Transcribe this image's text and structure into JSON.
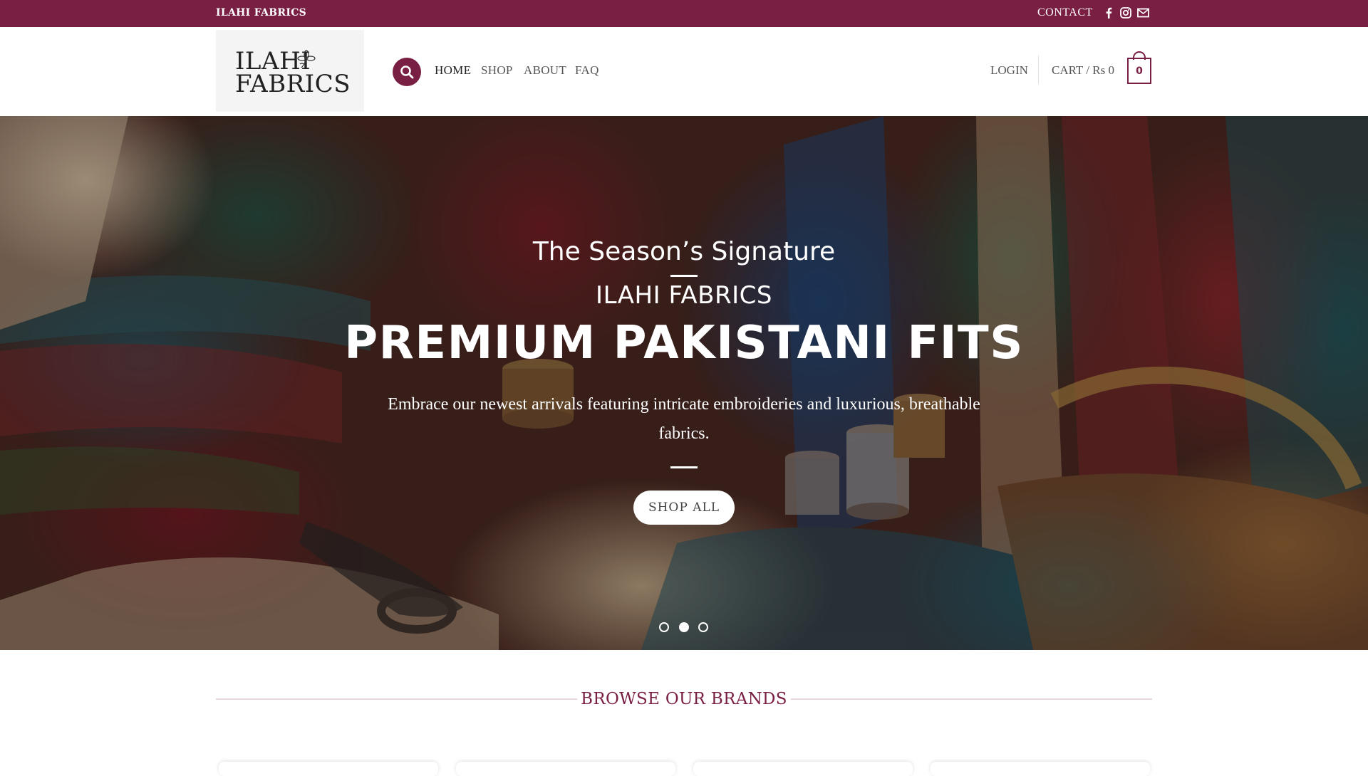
{
  "topbar": {
    "brand": "ILAHI FABRICS",
    "contact": "CONTACT",
    "social": [
      "facebook-icon",
      "instagram-icon",
      "mail-icon"
    ]
  },
  "header": {
    "logo": {
      "line1": "ILAHI",
      "line2": "FABRICS"
    },
    "nav": [
      "HOME",
      "SHOP",
      "ABOUT",
      "FAQ"
    ],
    "login": "LOGIN",
    "cart_label": "CART / Rs 0",
    "cart_count": "0"
  },
  "hero": {
    "kicker": "The Season’s Signature",
    "brand": "ILAHI FABRICS",
    "title": "PREMIUM PAKISTANI FITS",
    "description": "Embrace our newest arrivals featuring intricate embroideries and luxurious, breathable fabrics.",
    "button": "SHOP ALL",
    "slides": 3,
    "active_slide": 2
  },
  "browse": {
    "title": "BROWSE OUR BRANDS"
  },
  "colors": {
    "brand": "#7a1f44",
    "white": "#ffffff"
  }
}
